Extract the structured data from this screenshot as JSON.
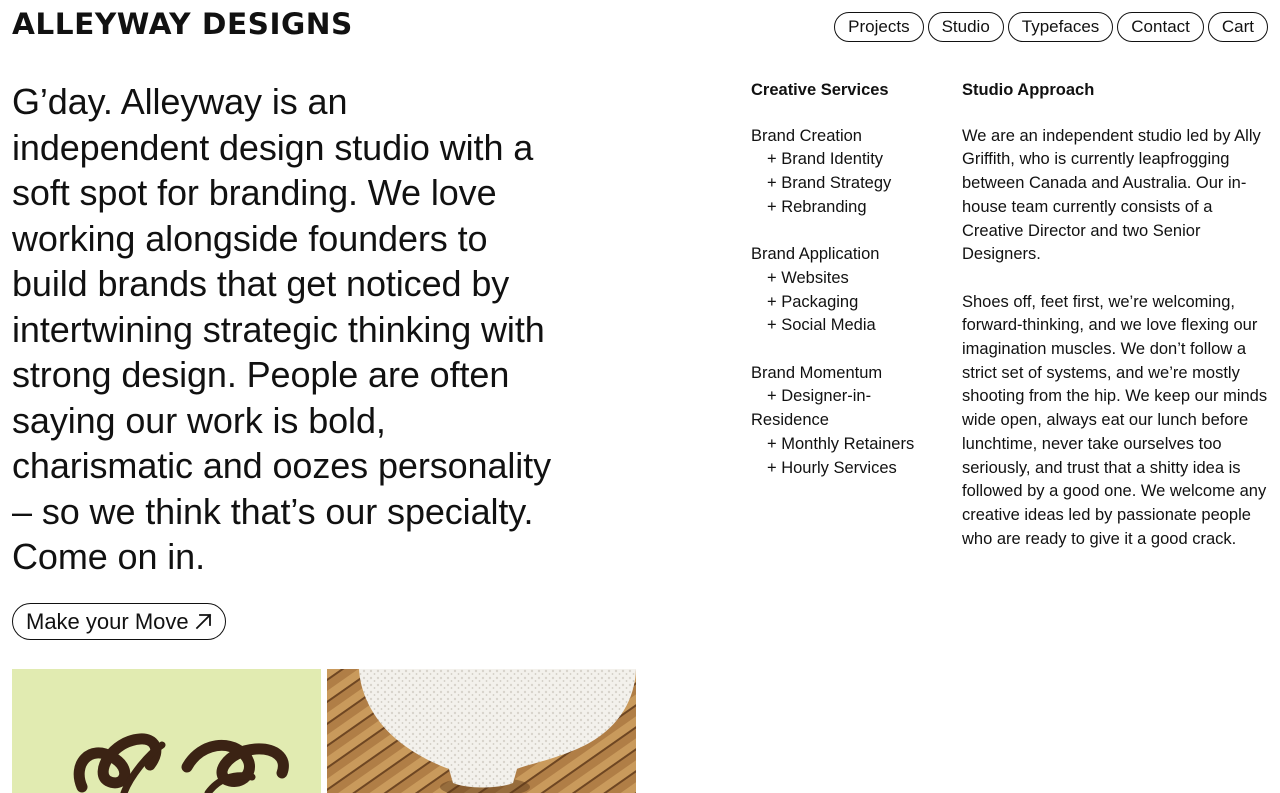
{
  "brand": {
    "name": "ALLEYWAY DESIGNS"
  },
  "nav": {
    "items": [
      {
        "label": "Projects"
      },
      {
        "label": "Studio"
      },
      {
        "label": "Typefaces"
      },
      {
        "label": "Contact"
      },
      {
        "label": "Cart"
      }
    ]
  },
  "intro": {
    "text": "G’day. Alleyway is an independent design studio with a soft spot for branding. We love working alongside founders to build brands that get noticed by intertwining strategic thinking with strong design. People are often saying our work is bold, charismatic and oozes personality – so we think that’s our specialty. Come on in."
  },
  "cta": {
    "label": "Make your Move",
    "icon": "arrow-up-right-icon"
  },
  "services": {
    "heading": "Creative Services",
    "groups": [
      {
        "title": "Brand Creation",
        "items": [
          "+ Brand Identity",
          "+ Brand Strategy",
          "+ Rebranding"
        ]
      },
      {
        "title": "Brand Application",
        "items": [
          "+ Websites",
          "+ Packaging",
          "+ Social Media"
        ]
      },
      {
        "title": "Brand Momentum",
        "items": [
          "+ Designer-in-Residence",
          "+ Monthly Retainers",
          "+ Hourly Services"
        ]
      }
    ]
  },
  "approach": {
    "heading": "Studio Approach",
    "paragraphs": [
      "We are an independent studio led by Ally Griffith, who is currently leapfrogging between Canada and Australia. Our in-house team currently consists of a Creative Director and two Senior Designers.",
      "Shoes off, feet first, we’re welcoming, forward-thinking, and we love flexing our imagination muscles. We don’t follow a strict set of systems, and we’re mostly shooting from the hip. We keep our minds wide open, always eat our lunch before lunchtime, never take ourselves too seriously, and trust that a shitty idea is followed by a good one. We welcome any creative ideas led by passionate people who are ready to give it a good crack."
    ]
  },
  "gallery": {
    "colors": {
      "tile_green": "#e1ebb1",
      "script_brown": "#3b2314",
      "rattan": "#b07e46",
      "sponge": "#f3f1ec"
    }
  }
}
